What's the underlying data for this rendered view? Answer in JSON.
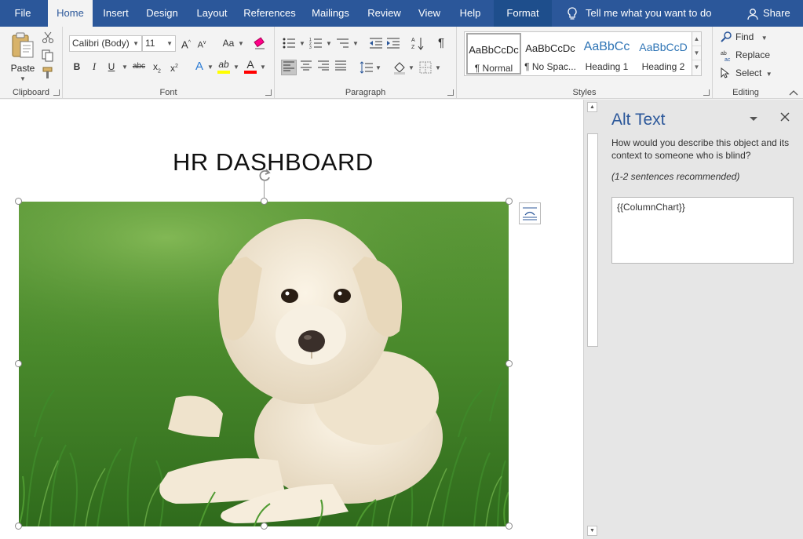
{
  "tabs": [
    {
      "label": "File"
    },
    {
      "label": "Home"
    },
    {
      "label": "Insert"
    },
    {
      "label": "Design"
    },
    {
      "label": "Layout"
    },
    {
      "label": "References"
    },
    {
      "label": "Mailings"
    },
    {
      "label": "Review"
    },
    {
      "label": "View"
    },
    {
      "label": "Help"
    },
    {
      "label": "Format"
    }
  ],
  "tell_me": "Tell me what you want to do",
  "share_label": "Share",
  "ribbon": {
    "clipboard": {
      "label": "Clipboard",
      "paste_label": "Paste"
    },
    "font": {
      "label": "Font",
      "font_name": "Calibri (Body)",
      "font_size": "11",
      "grow": "A",
      "shrink": "A",
      "change_case": "Aa",
      "bold": "B",
      "italic": "I",
      "underline": "U",
      "strikethrough": "abc",
      "subscript": "x",
      "superscript": "x",
      "text_effects": "A",
      "highlight": "ab",
      "font_color": "A"
    },
    "paragraph": {
      "label": "Paragraph"
    },
    "styles": {
      "label": "Styles",
      "items": [
        {
          "preview": "AaBbCcDc",
          "name": "¶ Normal",
          "color": "#000000"
        },
        {
          "preview": "AaBbCcDc",
          "name": "¶ No Spac...",
          "color": "#000000"
        },
        {
          "preview": "AaBbCc",
          "name": "Heading 1",
          "color": "#2e74b5"
        },
        {
          "preview": "AaBbCcD",
          "name": "Heading 2",
          "color": "#2e74b5"
        }
      ]
    },
    "editing": {
      "label": "Editing",
      "find": "Find",
      "replace": "Replace",
      "select": "Select"
    }
  },
  "document": {
    "title": "HR DASHBOARD",
    "image_subject": "puppy-on-grass-photo"
  },
  "alt_text_pane": {
    "title": "Alt Text",
    "description": "How would you describe this object and its context to someone who is blind?",
    "hint": "(1-2 sentences recommended)",
    "value": "{{ColumnChart}}"
  },
  "colors": {
    "accent": "#2b579a",
    "highlight_bar": "#ffff00",
    "font_color_bar": "#ff0000"
  }
}
